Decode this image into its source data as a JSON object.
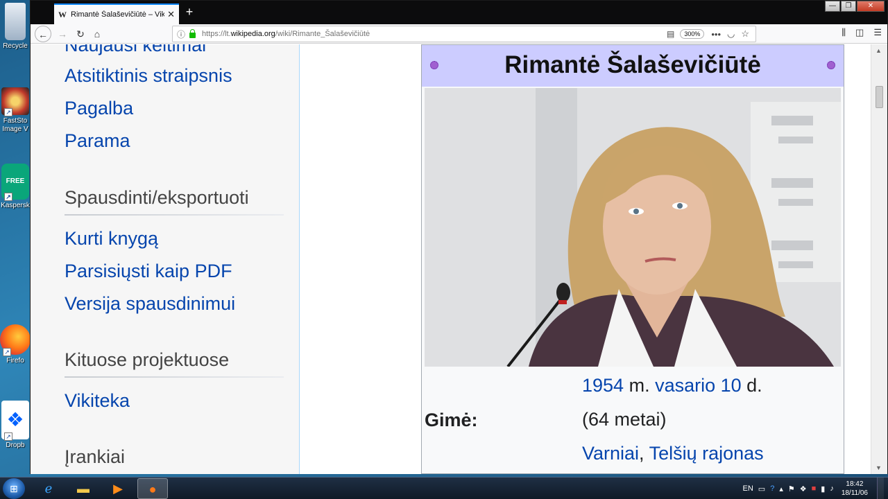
{
  "desktop": {
    "icons": [
      {
        "label": "Recycle"
      },
      {
        "label": "FastSto Image V"
      },
      {
        "label": "Kaspersk"
      },
      {
        "label": "Firefo"
      },
      {
        "label": "Dropb"
      }
    ]
  },
  "browser": {
    "tab": {
      "favicon": "W",
      "title": "Rimantė Šalaševičiūtė – Vikiped",
      "close": "✕"
    },
    "new_tab": "+",
    "url_prefix": "https://lt.",
    "url_domain": "wikipedia.org",
    "url_path": "/wiki/Rimante_Šalaševičiūtė",
    "zoom": "300%"
  },
  "sidebar": {
    "top_partial_link": "Naujausi keitimai",
    "nav_links": [
      "Atsitiktinis straipsnis",
      "Pagalba",
      "Parama"
    ],
    "print_heading": "Spausdinti/eksportuoti",
    "print_links": [
      "Kurti knygą",
      "Parsisiųsti kaip PDF",
      "Versija spausdinimui"
    ],
    "projects_heading": "Kituose projektuose",
    "projects_links": [
      "Vikiteka"
    ],
    "tools_heading": "Įrankiai"
  },
  "infobox": {
    "title": "Rimantė Šalaševičiūtė",
    "born_label": "Gimė:",
    "born_year": "1954",
    "born_mid": " m. ",
    "born_date": "vasario 10",
    "born_end": " d.",
    "age": "(64 metai)",
    "place_1": "Varniai",
    "place_sep": ", ",
    "place_2": "Telšių rajonas"
  },
  "taskbar": {
    "lang": "EN",
    "time": "18:42",
    "date": "18/11/06"
  },
  "colors": {
    "link": "#0645ad",
    "infobox_header": "#ccccff",
    "sidebar_bg": "#f6f6f6"
  }
}
